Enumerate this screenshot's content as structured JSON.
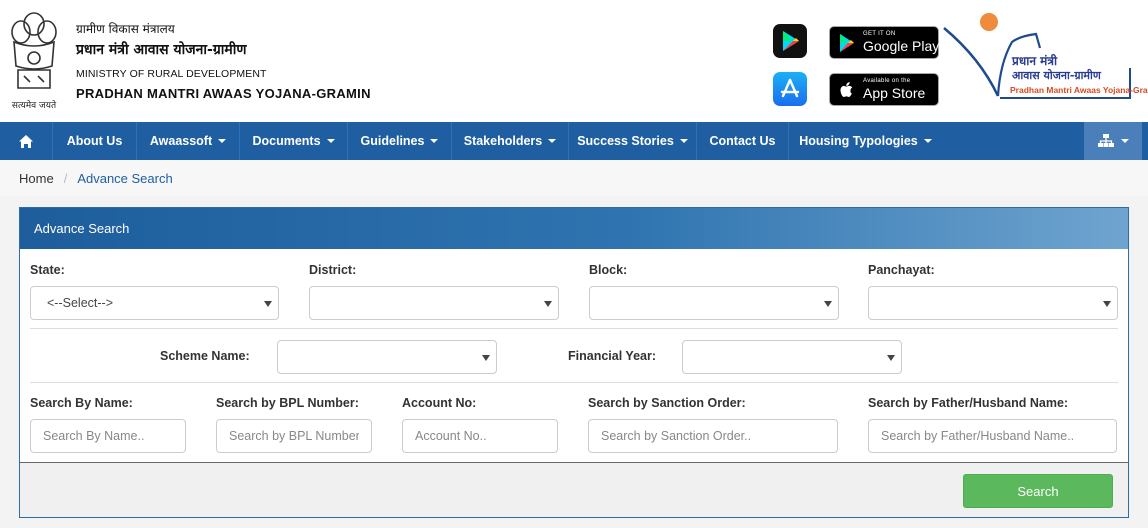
{
  "header": {
    "hindi_ministry": "ग्रामीण विकास मंत्रालय",
    "hindi_scheme": "प्रधान मंत्री आवास योजना-ग्रामीण",
    "ministry": "MINISTRY OF RURAL DEVELOPMENT",
    "scheme": "PRADHAN MANTRI AWAAS YOJANA-GRAMIN",
    "emblem_caption": "सत्यमेव जयते",
    "google_play": {
      "small": "GET IT ON",
      "big": "Google Play"
    },
    "app_store": {
      "small": "Available on the",
      "big": "App Store"
    },
    "logo_line1": "प्रधान मंत्री",
    "logo_line2": "आवास योजना-ग्रामीण",
    "logo_line3": "Pradhan Mantri Awaas Yojana-Gramin"
  },
  "nav": {
    "items": [
      {
        "label": "About Us",
        "dropdown": false
      },
      {
        "label": "Awaassoft",
        "dropdown": true
      },
      {
        "label": "Documents",
        "dropdown": true
      },
      {
        "label": "Guidelines",
        "dropdown": true
      },
      {
        "label": "Stakeholders",
        "dropdown": true
      },
      {
        "label": "Success Stories",
        "dropdown": true
      },
      {
        "label": "Contact Us",
        "dropdown": false
      },
      {
        "label": "Housing Typologies",
        "dropdown": true
      }
    ]
  },
  "breadcrumb": {
    "home": "Home",
    "current": "Advance Search"
  },
  "panel": {
    "title": "Advance Search",
    "state": {
      "label": "State:",
      "value": "<--Select-->"
    },
    "district": {
      "label": "District:",
      "value": ""
    },
    "block": {
      "label": "Block:",
      "value": ""
    },
    "panchayat": {
      "label": "Panchayat:",
      "value": ""
    },
    "scheme": {
      "label": "Scheme Name:",
      "value": ""
    },
    "fin_year": {
      "label": "Financial Year:",
      "value": ""
    },
    "by_name": {
      "label": "Search By Name:",
      "placeholder": "Search By Name.."
    },
    "by_bpl": {
      "label": "Search by BPL Number:",
      "placeholder": "Search by BPL Number."
    },
    "account": {
      "label": "Account No:",
      "placeholder": "Account No.."
    },
    "sanction": {
      "label": "Search by Sanction Order:",
      "placeholder": "Search by Sanction Order.."
    },
    "father": {
      "label": "Search by Father/Husband Name:",
      "placeholder": "Search by Father/Husband Name.."
    },
    "search_button": "Search"
  },
  "colors": {
    "nav": "#1f5fa1",
    "accent": "#5cb85c",
    "logo_orange": "#f08a3c"
  }
}
